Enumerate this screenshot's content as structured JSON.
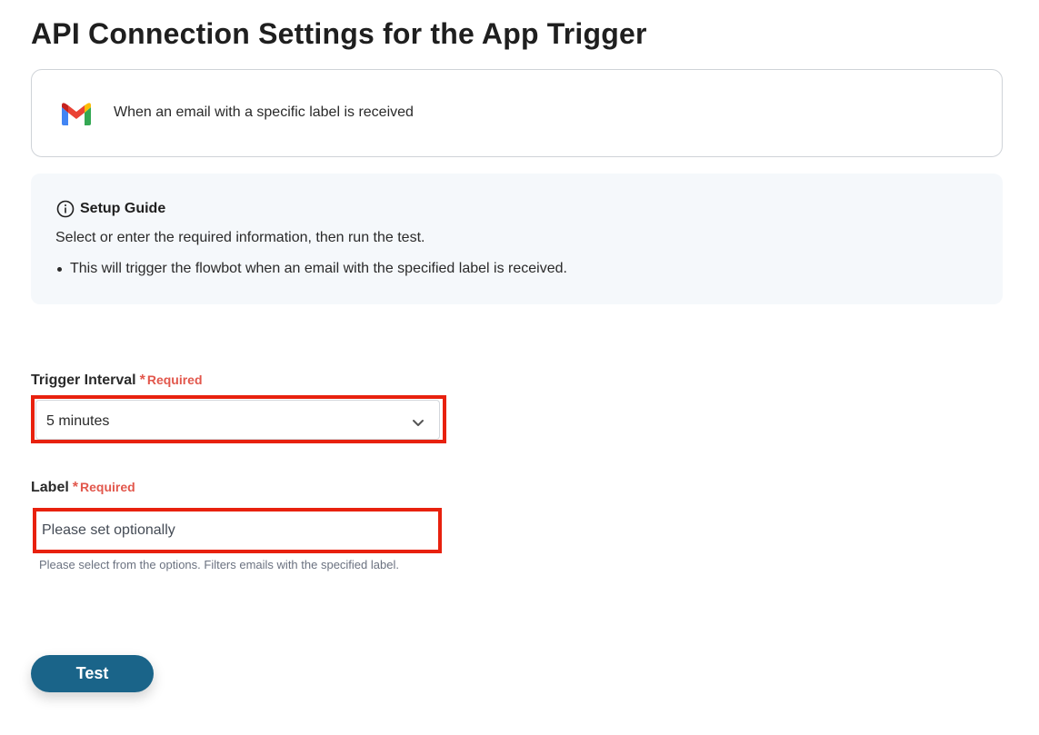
{
  "page": {
    "title": "API Connection Settings for the App Trigger"
  },
  "trigger_card": {
    "icon": "gmail-icon",
    "text": "When an email with a specific label is received"
  },
  "setup_guide": {
    "icon": "info-icon",
    "title": "Setup Guide",
    "description": "Select or enter the required information, then run the test.",
    "bullets": [
      "This will trigger the flowbot when an email with the specified label is received."
    ]
  },
  "fields": {
    "trigger_interval": {
      "label": "Trigger Interval",
      "required_text": "Required",
      "value": "5 minutes"
    },
    "label": {
      "label": "Label",
      "required_text": "Required",
      "placeholder": "Please set optionally",
      "help": "Please select from the options. Filters emails with the specified label."
    }
  },
  "actions": {
    "test_label": "Test"
  },
  "colors": {
    "highlight": "#e8210e",
    "required": "#e2574c",
    "button": "#1a6489",
    "guide_bg": "#f5f8fb"
  }
}
